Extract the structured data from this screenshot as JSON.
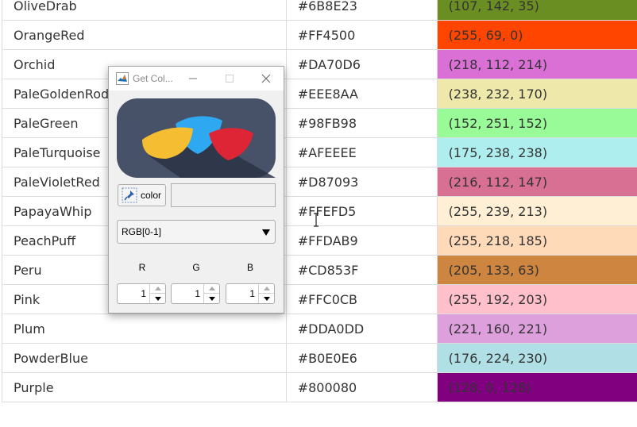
{
  "colors_table": {
    "rows": [
      {
        "name": "OliveDrab",
        "hex": "#6B8E23",
        "rgb": "(107, 142, 35)",
        "swatch": "#6B8E23"
      },
      {
        "name": "OrangeRed",
        "hex": "#FF4500",
        "rgb": "(255, 69, 0)",
        "swatch": "#FF4500"
      },
      {
        "name": "Orchid",
        "hex": "#DA70D6",
        "rgb": "(218, 112, 214)",
        "swatch": "#DA70D6"
      },
      {
        "name": "PaleGoldenRod",
        "hex": "#EEE8AA",
        "rgb": "(238, 232, 170)",
        "swatch": "#EEE8AA"
      },
      {
        "name": "PaleGreen",
        "hex": "#98FB98",
        "rgb": "(152, 251, 152)",
        "swatch": "#98FB98"
      },
      {
        "name": "PaleTurquoise",
        "hex": "#AFEEEE",
        "rgb": "(175, 238, 238)",
        "swatch": "#AFEEEE"
      },
      {
        "name": "PaleVioletRed",
        "hex": "#D87093",
        "rgb": "(216, 112, 147)",
        "swatch": "#D87093"
      },
      {
        "name": "PapayaWhip",
        "hex": "#FFEFD5",
        "rgb": "(255, 239, 213)",
        "swatch": "#FFEFD5"
      },
      {
        "name": "PeachPuff",
        "hex": "#FFDAB9",
        "rgb": "(255, 218, 185)",
        "swatch": "#FFDAB9"
      },
      {
        "name": "Peru",
        "hex": "#CD853F",
        "rgb": "(205, 133, 63)",
        "swatch": "#CD853F"
      },
      {
        "name": "Pink",
        "hex": "#FFC0CB",
        "rgb": "(255, 192, 203)",
        "swatch": "#FFC0CB"
      },
      {
        "name": "Plum",
        "hex": "#DDA0DD",
        "rgb": "(221, 160, 221)",
        "swatch": "#DDA0DD"
      },
      {
        "name": "PowderBlue",
        "hex": "#B0E0E6",
        "rgb": "(176, 224, 230)",
        "swatch": "#B0E0E6"
      },
      {
        "name": "Purple",
        "hex": "#800080",
        "rgb": "(128, 0, 128)",
        "swatch": "#800080"
      }
    ]
  },
  "dialog": {
    "title": "Get Col...",
    "app_icon": "matlab-icon",
    "color_button_label": "color",
    "color_field_value": "",
    "format_select_value": "RGB[0-1]",
    "channels": [
      {
        "label": "R",
        "value": "1"
      },
      {
        "label": "G",
        "value": "1"
      },
      {
        "label": "B",
        "value": "1"
      }
    ],
    "logo_colors": {
      "background": "#475167",
      "shadow": "#2c3345",
      "yellow": "#F5BD32",
      "blue": "#2EA8F0",
      "red": "#DD2535"
    }
  }
}
